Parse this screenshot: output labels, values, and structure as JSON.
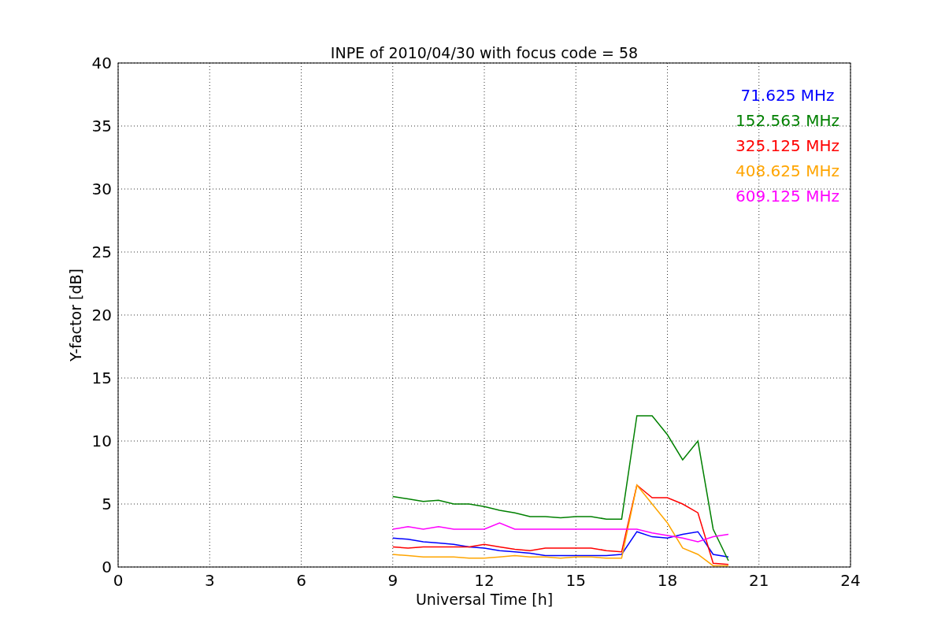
{
  "figure": {
    "chart_data": {
      "type": "line",
      "title": "INPE of 2010/04/30 with focus code = 58",
      "xlabel": "Universal Time [h]",
      "ylabel": "Y-factor [dB]",
      "x": [
        9,
        9.5,
        10,
        10.5,
        11,
        11.5,
        12,
        12.5,
        13,
        13.5,
        14,
        14.5,
        15,
        15.5,
        16,
        16.5,
        17,
        17.5,
        18,
        18.5,
        19,
        19.5,
        20
      ],
      "series": [
        {
          "name": "71.625 MHz",
          "color": "#0000ff",
          "values": [
            2.3,
            2.2,
            2.0,
            1.9,
            1.8,
            1.6,
            1.5,
            1.3,
            1.2,
            1.1,
            0.9,
            0.9,
            0.9,
            0.9,
            0.9,
            1.0,
            2.8,
            2.4,
            2.3,
            2.6,
            2.8,
            1.0,
            0.8
          ]
        },
        {
          "name": "152.563 MHz",
          "color": "#008000",
          "values": [
            5.6,
            5.4,
            5.2,
            5.3,
            5.0,
            5.0,
            4.8,
            4.5,
            4.3,
            4.0,
            4.0,
            3.9,
            4.0,
            4.0,
            3.8,
            3.8,
            12,
            12,
            10.5,
            8.5,
            10,
            3,
            0.5
          ]
        },
        {
          "name": "325.125 MHz",
          "color": "#ff0000",
          "values": [
            1.6,
            1.5,
            1.6,
            1.6,
            1.6,
            1.6,
            1.8,
            1.6,
            1.4,
            1.3,
            1.5,
            1.5,
            1.5,
            1.5,
            1.3,
            1.2,
            6.5,
            5.5,
            5.5,
            5.0,
            4.3,
            0.3,
            0.2
          ]
        },
        {
          "name": "408.625 MHz",
          "color": "#ffa500",
          "values": [
            1.0,
            0.9,
            0.8,
            0.8,
            0.8,
            0.7,
            0.7,
            0.8,
            0.9,
            0.8,
            0.8,
            0.7,
            0.8,
            0.8,
            0.7,
            0.7,
            6.5,
            5,
            3.5,
            1.5,
            1.0,
            0.1,
            0.1
          ]
        },
        {
          "name": "609.125 MHz",
          "color": "#ff00ff",
          "values": [
            3.0,
            3.2,
            3.0,
            3.2,
            3.0,
            3.0,
            3.0,
            3.5,
            3.0,
            3.0,
            3.0,
            3.0,
            3.0,
            3.0,
            3.0,
            3.0,
            3.0,
            2.7,
            2.5,
            2.3,
            2.0,
            2.4,
            2.6
          ]
        }
      ],
      "xlim": [
        0,
        24
      ],
      "ylim": [
        0,
        40
      ],
      "xticks": [
        0,
        3,
        6,
        9,
        12,
        15,
        18,
        21,
        24
      ],
      "yticks": [
        0,
        5,
        10,
        15,
        20,
        25,
        30,
        35,
        40
      ],
      "grid": true
    }
  }
}
